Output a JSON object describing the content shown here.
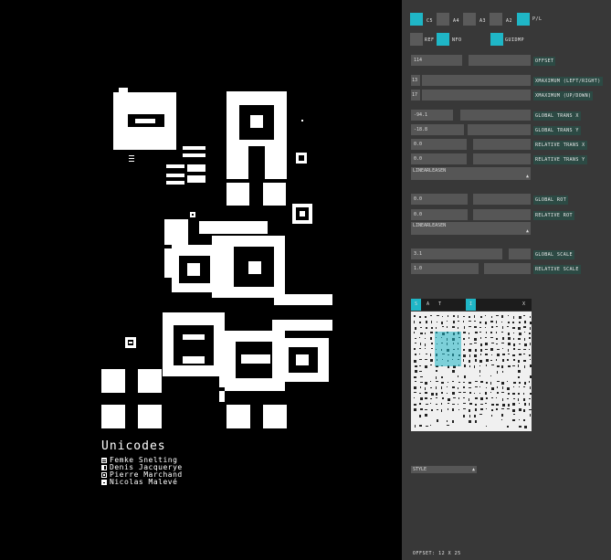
{
  "canvas": {
    "credits": {
      "title": "Unicodes",
      "authors": [
        {
          "name": "Femke Snelting",
          "glyph": "list-glyph-icon"
        },
        {
          "name": "Denis Jacquerye",
          "glyph": "columns-glyph-icon"
        },
        {
          "name": "Pierre Marchand",
          "glyph": "dot-square-glyph-icon"
        },
        {
          "name": "Nicolas Malevé",
          "glyph": "filled-square-glyph-icon"
        }
      ]
    }
  },
  "panel": {
    "format_buttons": [
      {
        "label": "C5",
        "active": true
      },
      {
        "label": "A4",
        "active": false
      },
      {
        "label": "A3",
        "active": false
      },
      {
        "label": "A2",
        "active": false
      },
      {
        "label": "P/L",
        "active": true
      }
    ],
    "toggles": [
      {
        "label": "REF",
        "active": false
      },
      {
        "label": "NFO",
        "active": true
      },
      {
        "label": "GUIDMP",
        "active": true
      }
    ],
    "offset": {
      "value": "114",
      "label": "OFFSET"
    },
    "xmaximum": {
      "value": "13",
      "label": "XMAXIMUM  (LEFT/RIGHT)"
    },
    "ymaximum": {
      "value": "17",
      "label": "XMAXIMUM  (UP/DOWN)"
    },
    "global_trans_x": {
      "value": "-94.1",
      "label": "GLOBAL TRANS X"
    },
    "global_trans_y": {
      "value": "-18.8",
      "label": "GLOBAL TRANS Y"
    },
    "relative_trans_x": {
      "value": "0.0",
      "label": "RELATIVE TRANS X"
    },
    "relative_trans_y": {
      "value": "0.0",
      "label": "RELATIVE TRANS Y"
    },
    "trans_easing": {
      "value": "LINEARLEASEN"
    },
    "global_rot": {
      "value": "0.0",
      "label": "GLOBAL ROT"
    },
    "relative_rot": {
      "value": "0.0",
      "label": "RELATIVE ROT"
    },
    "rot_easing": {
      "value": "LINEARLEASEN"
    },
    "global_scale": {
      "value": "3.1",
      "label": "GLOBAL SCALE"
    },
    "relative_scale": {
      "value": "1.0",
      "label": "RELATIVE SCALE"
    },
    "palette_tabs": [
      {
        "label": "S",
        "active": true
      },
      {
        "label": "A",
        "active": false
      },
      {
        "label": "T",
        "active": false
      },
      {
        "label": "I",
        "active": true
      },
      {
        "label": "X",
        "active": false
      }
    ],
    "style_select": {
      "value": "STYLE"
    },
    "status": "OFFSET: 12 X 25",
    "accent_color": "#1fb6c6",
    "panel_color": "#383838"
  }
}
